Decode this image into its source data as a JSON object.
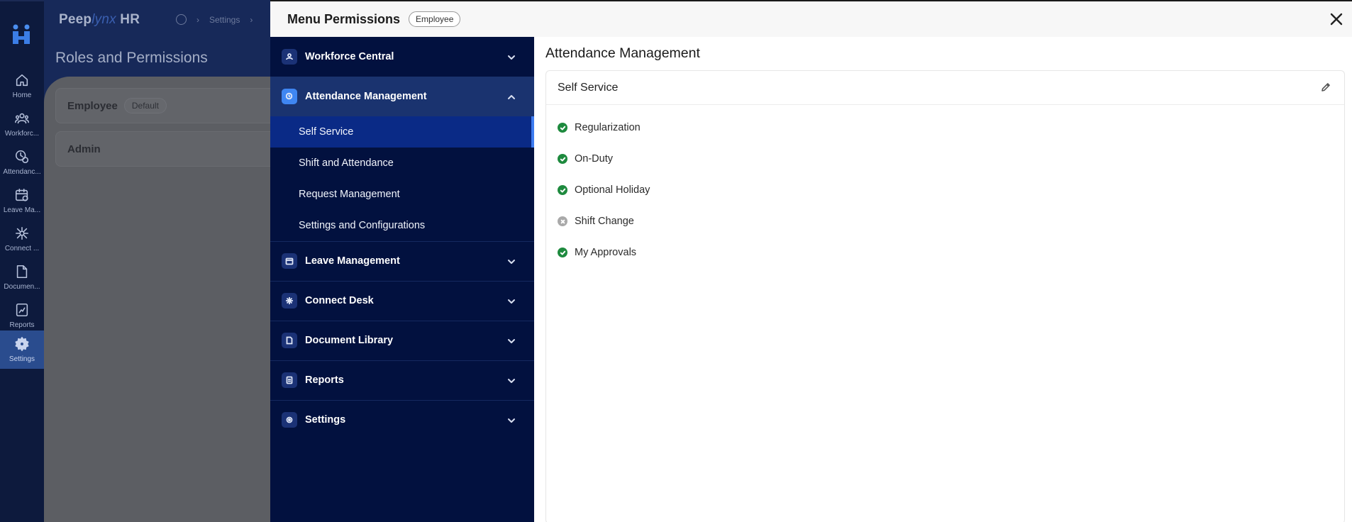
{
  "rail": {
    "items": [
      {
        "label": "Home",
        "icon": "home-icon"
      },
      {
        "label": "Workforc...",
        "icon": "people-icon"
      },
      {
        "label": "Attendanc...",
        "icon": "attendance-icon"
      },
      {
        "label": "Leave Ma...",
        "icon": "calendar-icon"
      },
      {
        "label": "Connect ...",
        "icon": "connect-icon"
      },
      {
        "label": "Documen...",
        "icon": "folder-icon"
      },
      {
        "label": "Reports",
        "icon": "report-icon"
      },
      {
        "label": "Settings",
        "icon": "gear-icon",
        "active": true
      }
    ]
  },
  "background": {
    "brand_start": "Peep",
    "brand_mid": "lynx",
    "brand_end": " HR",
    "breadcrumb": "Settings",
    "page_title": "Roles and Permissions",
    "roles": [
      {
        "name": "Employee",
        "tag": "Default"
      },
      {
        "name": "Admin"
      }
    ]
  },
  "modal": {
    "title": "Menu Permissions",
    "badge": "Employee",
    "menu": [
      {
        "label": "Workforce Central",
        "icon": "workforce-icon"
      },
      {
        "label": "Attendance Management",
        "icon": "attendance-icon",
        "open": true,
        "items": [
          "Self Service",
          "Shift and Attendance",
          "Request Management",
          "Settings and Configurations"
        ],
        "active_item": "Self Service"
      },
      {
        "label": "Leave Management",
        "icon": "calendar-icon"
      },
      {
        "label": "Connect Desk",
        "icon": "connect-icon"
      },
      {
        "label": "Document Library",
        "icon": "folder-icon"
      },
      {
        "label": "Reports",
        "icon": "report-icon"
      },
      {
        "label": "Settings",
        "icon": "gear-icon"
      }
    ],
    "content": {
      "title": "Attendance Management",
      "section": "Self Service",
      "permissions": [
        {
          "label": "Regularization",
          "enabled": true
        },
        {
          "label": "On-Duty",
          "enabled": true
        },
        {
          "label": "Optional Holiday",
          "enabled": true
        },
        {
          "label": "Shift Change",
          "enabled": false
        },
        {
          "label": "My Approvals",
          "enabled": true
        }
      ]
    }
  },
  "colors": {
    "menu_bg": "#02113f",
    "accent": "#3d7cf0",
    "enabled": "#1e8a3e",
    "disabled": "#a9a9a9"
  }
}
